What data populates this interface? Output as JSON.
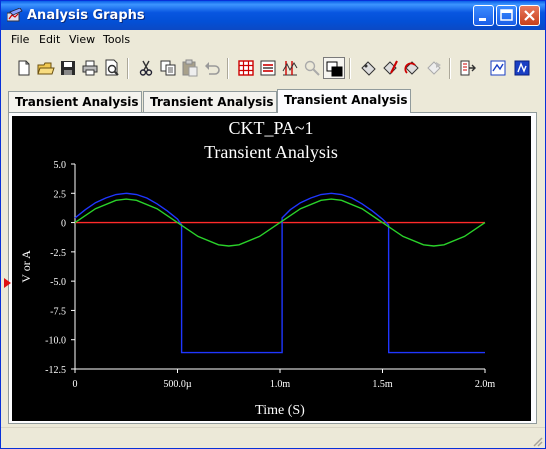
{
  "window": {
    "title": "Analysis Graphs",
    "icon": "graph-window-icon",
    "controls": [
      "minimize-icon",
      "maximize-icon",
      "close-icon"
    ]
  },
  "menu": [
    "File",
    "Edit",
    "View",
    "Tools"
  ],
  "toolbar": {
    "tools": [
      "new-icon",
      "open-icon",
      "save-icon",
      "print-icon",
      "print-preview-icon",
      "cut-icon",
      "copy-icon",
      "paste-icon",
      "undo-icon",
      "toggle-grid-icon",
      "toggle-legend-icon",
      "cursors-icon",
      "zoom-icon",
      "reverse-colors-icon",
      "select-trace-icon",
      "pen-edit-icon",
      "restore-icon",
      "flag-icon",
      "export-icon",
      "overlay-traces-icon",
      "properties-icon"
    ],
    "pressed_tool": "reverse-colors-icon"
  },
  "tabs": [
    "Transient Analysis",
    "Transient Analysis",
    "Transient Analysis"
  ],
  "active_tab": 2,
  "chart_data": {
    "type": "line",
    "title": "CKT_PA~1",
    "subtitle": "Transient Analysis",
    "xlabel": "Time (S)",
    "ylabel": "V or A",
    "xlim": [
      0,
      0.002
    ],
    "ylim": [
      -12.5,
      5.0
    ],
    "xticks": [
      {
        "value": 0,
        "label": "0"
      },
      {
        "value": 0.0005,
        "label": "500.0µ"
      },
      {
        "value": 0.001,
        "label": "1.0m"
      },
      {
        "value": 0.0015,
        "label": "1.5m"
      },
      {
        "value": 0.002,
        "label": "2.0m"
      }
    ],
    "yticks": [
      {
        "value": 5.0,
        "label": "5.0"
      },
      {
        "value": 2.5,
        "label": "2.5"
      },
      {
        "value": 0,
        "label": "0"
      },
      {
        "value": -2.5,
        "label": "-2.5"
      },
      {
        "value": -5.0,
        "label": "-5.0"
      },
      {
        "value": -7.5,
        "label": "-7.5"
      },
      {
        "value": -10.0,
        "label": "-10.0"
      },
      {
        "value": -12.5,
        "label": "-12.5"
      }
    ],
    "grid": false,
    "background": "#000000",
    "series": [
      {
        "color": "#ff2a2a",
        "x": [
          0,
          0.002
        ],
        "y": [
          0,
          0
        ]
      },
      {
        "color": "#1f36ff",
        "x": [
          0,
          5e-05,
          0.0001,
          0.00015,
          0.0002,
          0.00025,
          0.0003,
          0.00035,
          0.0004,
          0.00045,
          0.0005,
          0.00052,
          0.0005201,
          0.00101,
          0.0010101,
          0.00105,
          0.0011,
          0.00115,
          0.0012,
          0.00125,
          0.0013,
          0.00135,
          0.0014,
          0.00145,
          0.0015,
          0.00153,
          0.0015301,
          0.002
        ],
        "y": [
          0.4,
          1.1,
          1.7,
          2.1,
          2.4,
          2.5,
          2.4,
          2.1,
          1.6,
          1.0,
          0.3,
          -0.2,
          -11.1,
          -11.1,
          0.4,
          1.1,
          1.7,
          2.1,
          2.4,
          2.5,
          2.4,
          2.1,
          1.6,
          1.0,
          0.3,
          -0.2,
          -11.1,
          -11.1
        ]
      },
      {
        "color": "#2ad22a",
        "x": [
          0,
          0.0001,
          0.0002,
          0.00025,
          0.0003,
          0.0004,
          0.0005,
          0.0006,
          0.0007,
          0.00075,
          0.0008,
          0.0009,
          0.001,
          0.0011,
          0.0012,
          0.00125,
          0.0013,
          0.0014,
          0.0015,
          0.0016,
          0.0017,
          0.00175,
          0.0018,
          0.0019,
          0.002
        ],
        "y": [
          0,
          1.18,
          1.9,
          2.0,
          1.9,
          1.18,
          0,
          -1.18,
          -1.9,
          -2.0,
          -1.9,
          -1.18,
          0,
          1.18,
          1.9,
          2.0,
          1.9,
          1.18,
          0,
          -1.18,
          -1.9,
          -2.0,
          -1.9,
          -1.18,
          0
        ]
      }
    ]
  }
}
